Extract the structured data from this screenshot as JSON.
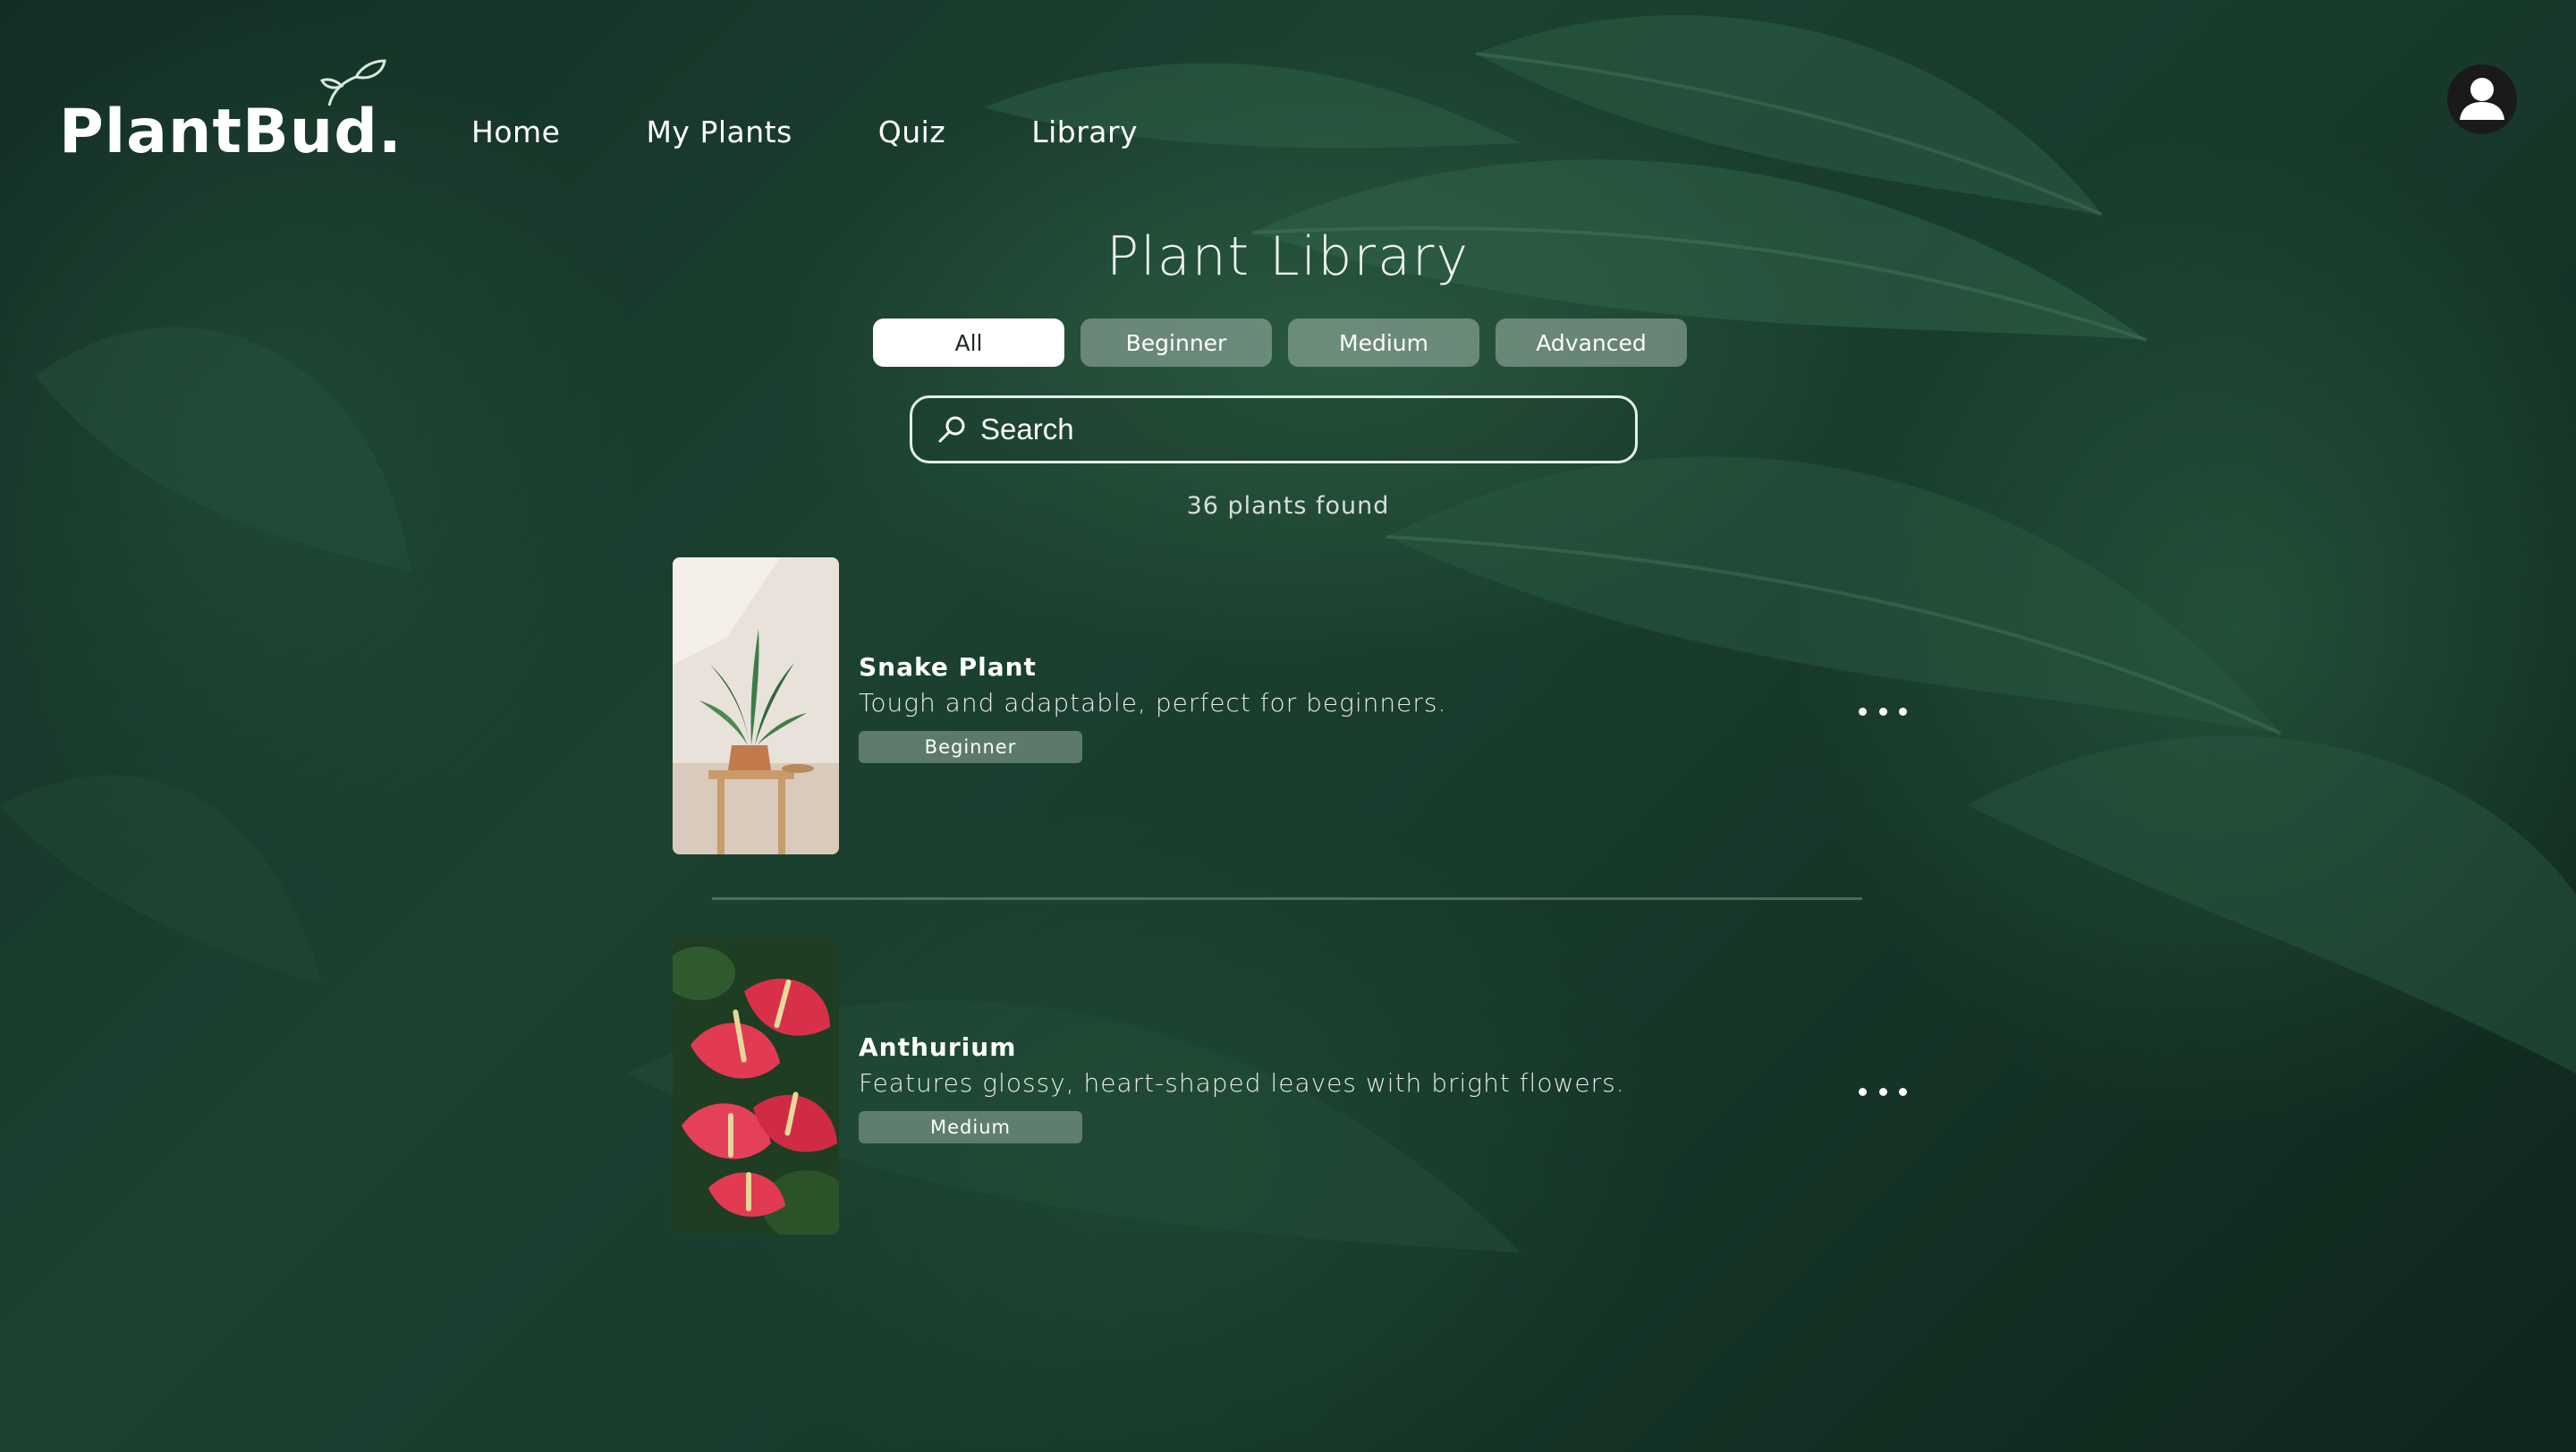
{
  "brand": {
    "name": "PlantBud."
  },
  "nav": {
    "items": [
      {
        "label": "Home"
      },
      {
        "label": "My Plants"
      },
      {
        "label": "Quiz"
      },
      {
        "label": "Library"
      }
    ]
  },
  "user": {
    "icon": "user-avatar-icon"
  },
  "library": {
    "title": "Plant Library",
    "filters": [
      {
        "label": "All",
        "active": true
      },
      {
        "label": "Beginner",
        "active": false
      },
      {
        "label": "Medium",
        "active": false
      },
      {
        "label": "Advanced",
        "active": false
      }
    ],
    "search": {
      "placeholder": "Search",
      "icon": "search-icon"
    },
    "count_text": "36 plants found",
    "plants": [
      {
        "name": "Snake Plant",
        "description": "Tough and adaptable, perfect for beginners.",
        "level": "Beginner"
      },
      {
        "name": "Anthurium",
        "description": "Features glossy, heart-shaped leaves with bright flowers.",
        "level": "Medium"
      }
    ]
  },
  "colors": {
    "background": "#1d4634",
    "active_filter_bg": "#ffffff",
    "inactive_filter_bg": "#aebbb3",
    "text": "#ffffff"
  }
}
